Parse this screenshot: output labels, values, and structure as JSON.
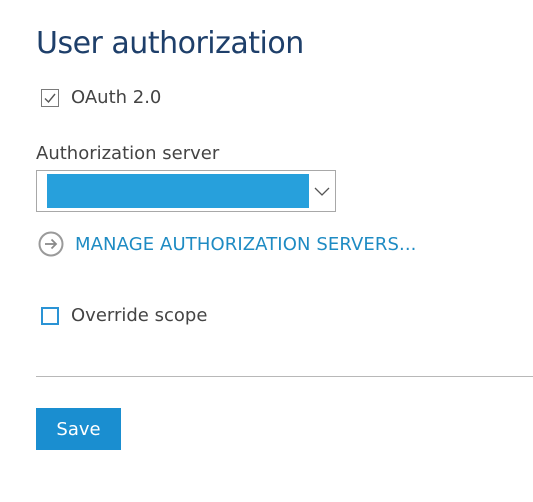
{
  "page": {
    "title": "User authorization"
  },
  "oauth": {
    "label": "OAuth 2.0",
    "checked": true
  },
  "authorization_server": {
    "label": "Authorization server",
    "selected_value": ""
  },
  "manage_link": {
    "label": "MANAGE AUTHORIZATION SERVERS..."
  },
  "override_scope": {
    "label": "Override scope",
    "checked": false
  },
  "actions": {
    "save_label": "Save"
  },
  "colors": {
    "title": "#1e3f6a",
    "accent": "#1a8ed0",
    "selection": "#27a0dc",
    "link": "#1e8bc3"
  },
  "icons": {
    "checkmark": "checkmark-icon",
    "dropdown": "chevron-down-icon",
    "link_arrow": "arrow-circle-right-icon"
  }
}
